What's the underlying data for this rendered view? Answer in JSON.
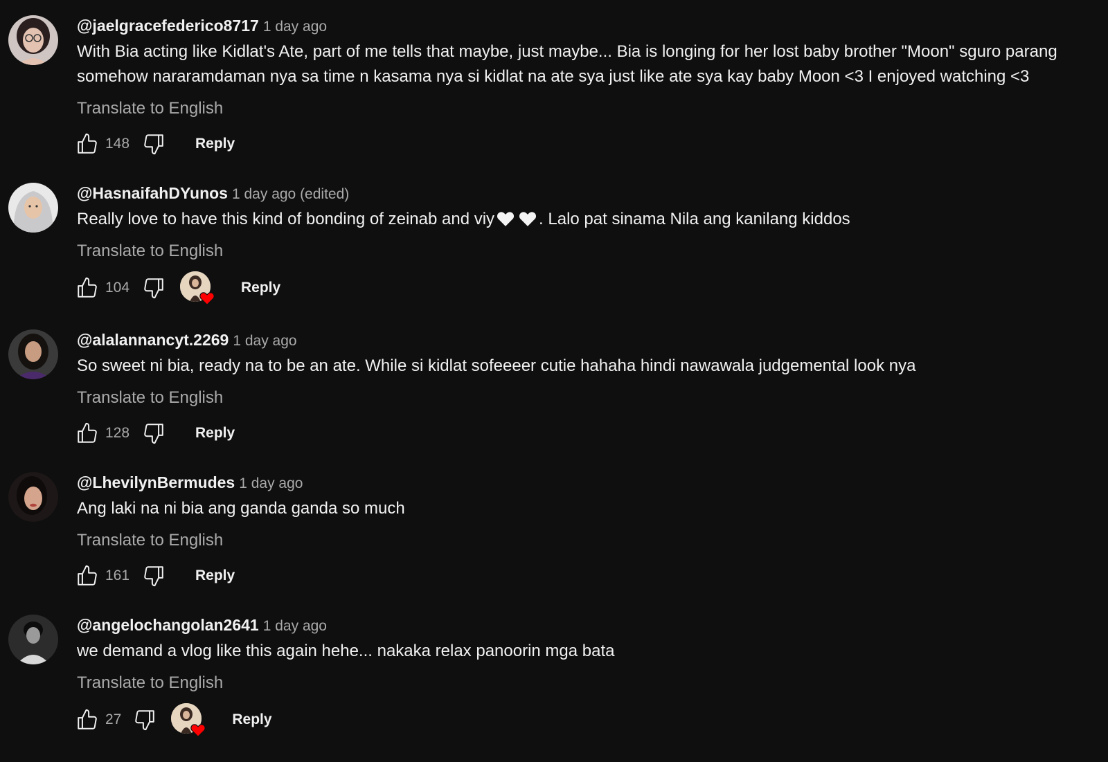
{
  "comments": [
    {
      "author": "@jaelgracefederico8717",
      "time": "1 day ago",
      "text_line1": "With Bia acting like Kidlat's Ate, part of me tells that maybe, just maybe... Bia is longing for her lost baby brother \"Moon\" sguro parang",
      "text_line2": "somehow nararamdaman nya sa time n kasama nya si kidlat na ate sya just like ate sya kay baby Moon <3 I enjoyed watching <3",
      "translate": "Translate to English",
      "likes": "148",
      "reply": "Reply",
      "avatar_icon": "avatar-woman-glasses",
      "creator_heart": false
    },
    {
      "author": "@HasnaifahDYunos",
      "time": "1 day ago (edited)",
      "text_pre": "Really love to have this kind of bonding of zeinab and viy",
      "text_post": ". Lalo pat sinama Nila ang kanilang kiddos",
      "translate": "Translate to English",
      "likes": "104",
      "reply": "Reply",
      "avatar_icon": "avatar-woman-hijab",
      "creator_heart": true
    },
    {
      "author": "@alalannancyt.2269",
      "time": "1 day ago",
      "text": "So sweet ni bia, ready na to be an ate. While si kidlat sofeeeer cutie hahaha hindi nawawala judgemental look nya",
      "translate": "Translate to English",
      "likes": "128",
      "reply": "Reply",
      "avatar_icon": "avatar-woman-dark-hair",
      "creator_heart": false
    },
    {
      "author": "@LhevilynBermudes",
      "time": "1 day ago",
      "text": "Ang laki na ni bia ang ganda ganda so much",
      "translate": "Translate to English",
      "likes": "161",
      "reply": "Reply",
      "avatar_icon": "avatar-woman-portrait",
      "creator_heart": false
    },
    {
      "author": "@angelochangolan2641",
      "time": "1 day ago",
      "text": "we demand a vlog like this again hehe... nakaka relax panoorin mga bata",
      "translate": "Translate to English",
      "likes": "27",
      "reply": "Reply",
      "avatar_icon": "avatar-man-monochrome",
      "creator_heart": true
    }
  ],
  "colors": {
    "background": "#0f0f0f",
    "primary_text": "#f1f1f1",
    "secondary_text": "#aaaaaa",
    "heart": "#ff0000"
  }
}
